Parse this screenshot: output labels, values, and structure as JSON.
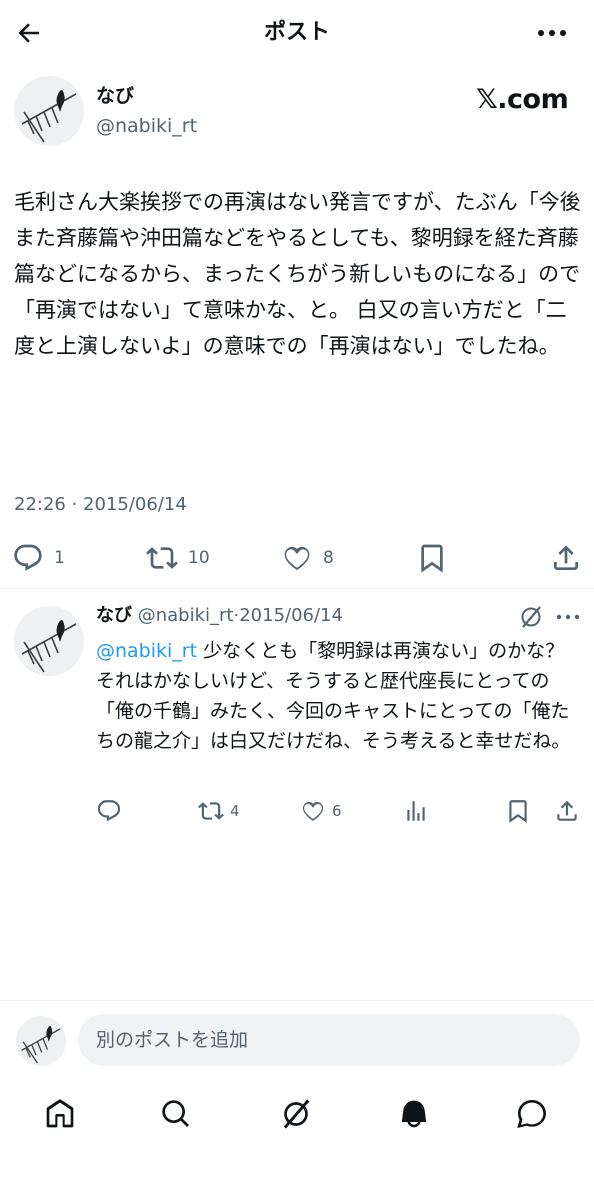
{
  "header": {
    "title": "ポスト",
    "back_icon": "arrow-left-icon",
    "more_icon": "more-horizontal-icon"
  },
  "post": {
    "author_name": "なび",
    "author_handle": "@nabiki_rt",
    "source_logo": "𝕏.com",
    "text": "毛利さん大楽挨拶での再演はない発言ですが、たぶん「今後また斉藤篇や沖田篇などをやるとしても、黎明録を経た斉藤篇などになるから、まったくちがう新しいものになる」ので「再演ではない」て意味かな、と。 白又の言い方だと「二度と上演しないよ」の意味での「再演はない」でしたね。",
    "timestamp": "22:26 · 2015/06/14",
    "stats": {
      "replies": "1",
      "reposts": "10",
      "likes": "8"
    }
  },
  "reply": {
    "author_name": "なび",
    "author_handle": "@nabiki_rt",
    "separator": "·",
    "date": "2015/06/14",
    "mention": "@nabiki_rt",
    "text": "少なくとも「黎明録は再演ない」のかな？ それはかなしいけど、そうすると歴代座長にとっての「俺の千鶴」みたく、今回のキャストにとっての「俺たちの龍之介」は白又だけだね、そう考えると幸せだね。",
    "stats": {
      "replies": "",
      "reposts": "4",
      "likes": "6"
    }
  },
  "compose": {
    "placeholder": "別のポストを追加"
  },
  "colors": {
    "text": "#0f1419",
    "muted": "#536471",
    "accent": "#1d9bf0",
    "divider": "#eff3f4"
  }
}
